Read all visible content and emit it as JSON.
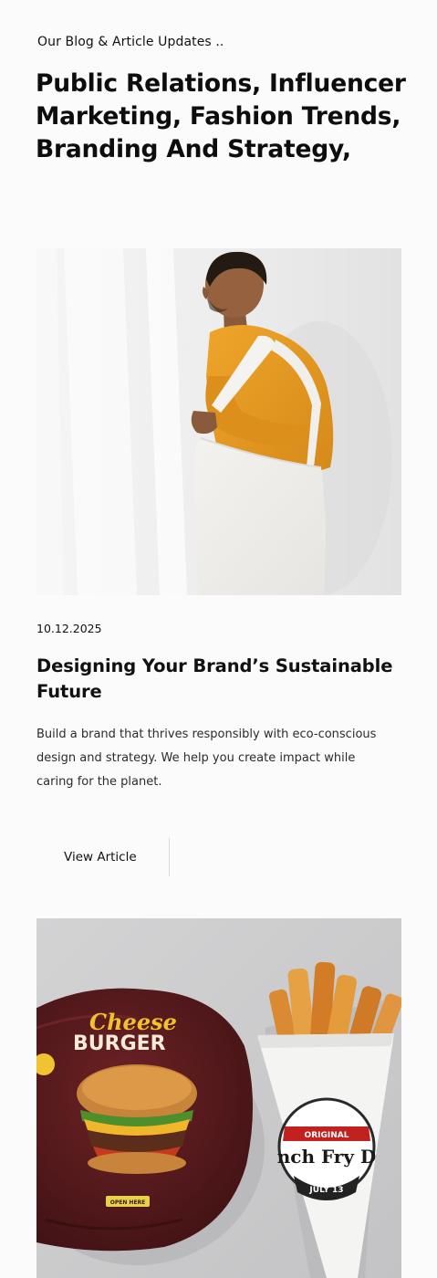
{
  "section": {
    "eyebrow": "Our Blog & Article Updates ..",
    "headline": "Public Relations, Influencer Marketing, Fashion Trends, Branding And Strategy,"
  },
  "posts": [
    {
      "date": "10.12.2025",
      "title": "Designing Your Brand’s Sustainable Future",
      "excerpt": "Build a brand that thrives responsibly with eco-conscious design and strategy. We help you create impact while caring for the planet.",
      "button_label": "View Article"
    }
  ],
  "second_post_image": {
    "wrapper_top_text": "Cheese",
    "wrapper_bottom_text": "BURGER",
    "wrapper_badge_text": "OPEN HERE",
    "cone_banner_text": "ORIGINAL",
    "cone_main_text": "nch Fry D",
    "cone_date_text": "JULY 13"
  },
  "colors": {
    "accent_orange": "#e59a1e",
    "burger_wrapper": "#5b1b1e",
    "cheese_yellow": "#f1c232"
  }
}
